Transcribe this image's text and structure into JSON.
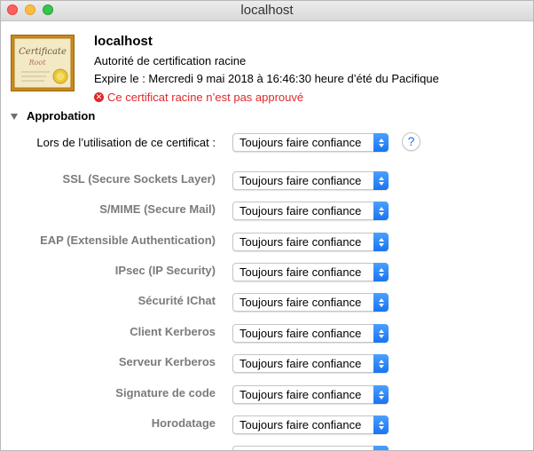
{
  "window": {
    "title": "localhost"
  },
  "certificate": {
    "name": "localhost",
    "type": "Autorité de certification racine",
    "expires": "Expire le : Mercredi 9 mai 2018 à 16:46:30 heure d’été du Pacifique",
    "warning": "Ce certificat racine n’est pas approuvé",
    "icon_title": "Certificate",
    "icon_subtitle": "Root"
  },
  "trust": {
    "section_label": "Approbation",
    "main_label": "Lors de l’utilisation de ce certificat :",
    "main_value": "Toujours faire confiance",
    "help_label": "?",
    "rows": [
      {
        "label": "SSL (Secure Sockets Layer)",
        "value": "Toujours faire confiance"
      },
      {
        "label": "S/MIME (Secure Mail)",
        "value": "Toujours faire confiance"
      },
      {
        "label": "EAP (Extensible Authentication)",
        "value": "Toujours faire confiance"
      },
      {
        "label": "IPsec (IP Security)",
        "value": "Toujours faire confiance"
      },
      {
        "label": "Sécurité IChat",
        "value": "Toujours faire confiance"
      },
      {
        "label": "Client Kerberos",
        "value": "Toujours faire confiance"
      },
      {
        "label": "Serveur Kerberos",
        "value": "Toujours faire confiance"
      },
      {
        "label": "Signature de code",
        "value": "Toujours faire confiance"
      },
      {
        "label": "Horodatage",
        "value": "Toujours faire confiance"
      }
    ]
  },
  "colors": {
    "warning": "#e0282b",
    "accent": "#1a74f0",
    "sub_label": "#7b7b7b"
  }
}
